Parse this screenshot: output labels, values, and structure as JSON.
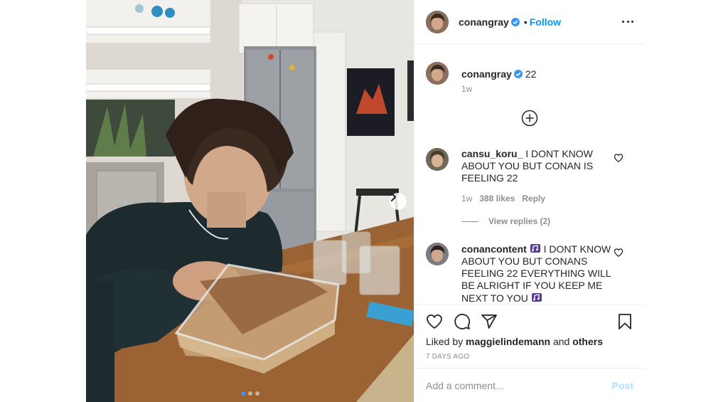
{
  "post": {
    "author": "conangray",
    "follow_separator": "•",
    "follow_label": "Follow",
    "caption_username": "conangray",
    "caption_text": "22",
    "caption_time": "1w",
    "image_count": 3,
    "active_image": 1
  },
  "comments": [
    {
      "username": "cansu_koru_",
      "text": "I DONT KNOW ABOUT YOU BUT CONAN IS FEELING 22",
      "time": "1w",
      "likes": "388 likes",
      "reply_label": "Reply"
    },
    {
      "username": "conancontent",
      "emoji_before": "🎼",
      "text": "I DONT KNOW ABOUT YOU BUT CONANS FEELING 22 EVERYTHING WILL BE ALRIGHT IF YOU KEEP ME NEXT TO YOU",
      "emoji_after": "🎼"
    }
  ],
  "view_replies": "View replies (2)",
  "actions": {
    "liked_prefix": "Liked by",
    "liked_user": "maggielindemann",
    "liked_and": "and",
    "liked_others": "others",
    "posted_ago": "7 DAYS AGO"
  },
  "add_comment": {
    "placeholder": "Add a comment...",
    "post_label": "Post"
  },
  "colors": {
    "link_blue": "#0095f6",
    "post_disabled": "#b2dffc",
    "verified_blue": "#3897f0",
    "muted": "#8e8e8e"
  },
  "icons": [
    "chevron-right-icon",
    "more-icon",
    "add-circle-icon",
    "heart-icon",
    "comment-icon",
    "share-icon",
    "bookmark-icon",
    "verified-icon"
  ]
}
